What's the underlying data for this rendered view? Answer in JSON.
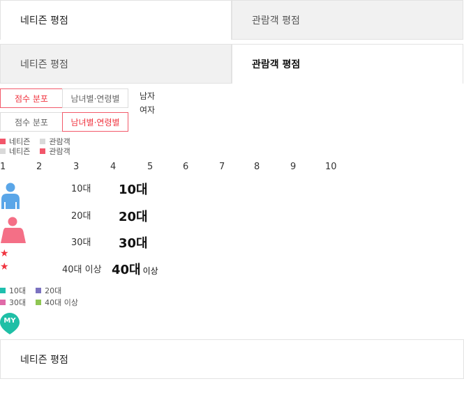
{
  "tabs_top": [
    {
      "label": "네티즌 평점",
      "active": true
    },
    {
      "label": "관람객 평점",
      "active": false
    }
  ],
  "tabs_second": [
    {
      "label": "네티즌 평점",
      "active": false
    },
    {
      "label": "관람객 평점",
      "active": true
    }
  ],
  "seg_row1": [
    {
      "label": "점수 분포",
      "active": true
    },
    {
      "label": "남녀별·연령별",
      "active": false
    }
  ],
  "seg_row2": [
    {
      "label": "점수 분포",
      "active": false
    },
    {
      "label": "남녀별·연령별",
      "active": true
    }
  ],
  "gender": {
    "male": "남자",
    "female": "여자"
  },
  "legend1": [
    {
      "label": "네티즌",
      "color": "#f2566a"
    },
    {
      "label": "관람객",
      "color": "#d9d9d9"
    }
  ],
  "legend2": [
    {
      "label": "네티즌",
      "color": "#d9d9d9"
    },
    {
      "label": "관람객",
      "color": "#f2566a"
    }
  ],
  "scale": [
    "1",
    "2",
    "3",
    "4",
    "5",
    "6",
    "7",
    "8",
    "9",
    "10"
  ],
  "ages": [
    {
      "small": "10대",
      "big": "10대",
      "suffix": ""
    },
    {
      "small": "20대",
      "big": "20대",
      "suffix": ""
    },
    {
      "small": "30대",
      "big": "30대",
      "suffix": ""
    },
    {
      "small": "40대 이상",
      "big": "40대",
      "suffix": "이상"
    }
  ],
  "age_legend": [
    {
      "label": "10대",
      "color": "#1fbfae"
    },
    {
      "label": "20대",
      "color": "#7b72c0"
    },
    {
      "label": "30대",
      "color": "#e06aa8"
    },
    {
      "label": "40대 이상",
      "color": "#8fc653"
    }
  ],
  "my_badge": "MY",
  "tabs_bottom": [
    {
      "label": "네티즌 평점",
      "active": true
    }
  ],
  "colors": {
    "accent": "#f0343f",
    "male": "#5aa6e8",
    "female": "#f46f86",
    "my": "#1fbfa6"
  }
}
